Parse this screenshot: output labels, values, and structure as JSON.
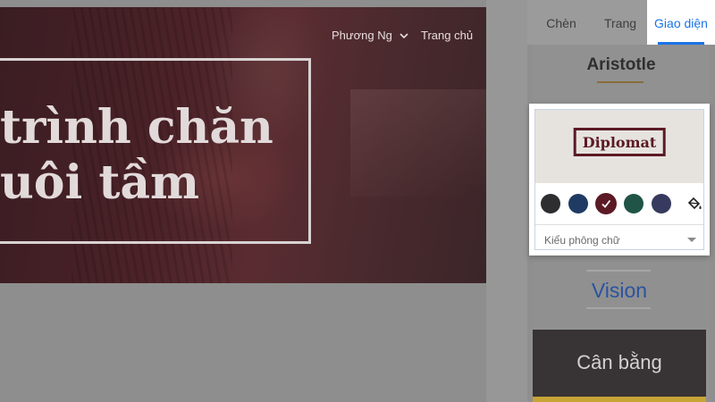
{
  "header": {
    "user_name": "Phương Ng",
    "home_link": "Trang chủ"
  },
  "hero": {
    "title_line1": "trình chăn",
    "title_line2": "uôi tầm"
  },
  "panel": {
    "tabs": [
      {
        "label": "Chèn"
      },
      {
        "label": "Trang"
      },
      {
        "label": "Giao diện",
        "active": true
      }
    ],
    "themes": {
      "aristotle": "Aristotle",
      "selected": {
        "name": "Diplomat",
        "colors": [
          "#2e2e30",
          "#1f3b64",
          "#5c1a24",
          "#205446",
          "#373a5e"
        ],
        "selected_color_index": 2,
        "font_style_label": "Kiểu phông chữ"
      },
      "vision": "Vision",
      "balance": "Cân bằng"
    }
  },
  "icons": {
    "chevron": "chevron-down-icon",
    "check": "check-icon",
    "paint": "paint-bucket-icon",
    "dropdown": "dropdown-arrow-icon"
  }
}
